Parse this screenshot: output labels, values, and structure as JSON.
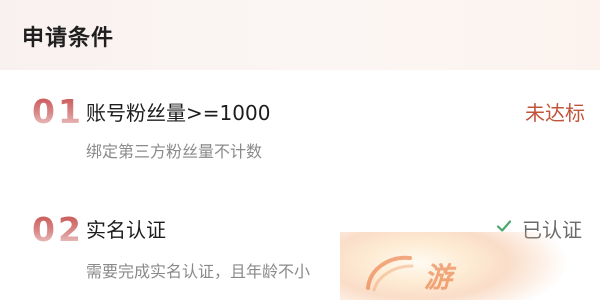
{
  "section": {
    "title": "申请条件"
  },
  "requirements": [
    {
      "number": "01",
      "title": "账号粉丝量>=1000",
      "description": "绑定第三方粉丝量不计数",
      "status": "未达标",
      "status_color": "#c0553a"
    },
    {
      "number": "02",
      "title": "实名认证",
      "description": "需要完成实名认证，且年龄不小",
      "status": "已认证",
      "status_color": "#6b6b6b",
      "status_icon": "check-icon"
    }
  ],
  "watermark": {
    "text": "游"
  },
  "colors": {
    "accent": "#c74a4a",
    "header_bg": "#fbf6f4"
  }
}
